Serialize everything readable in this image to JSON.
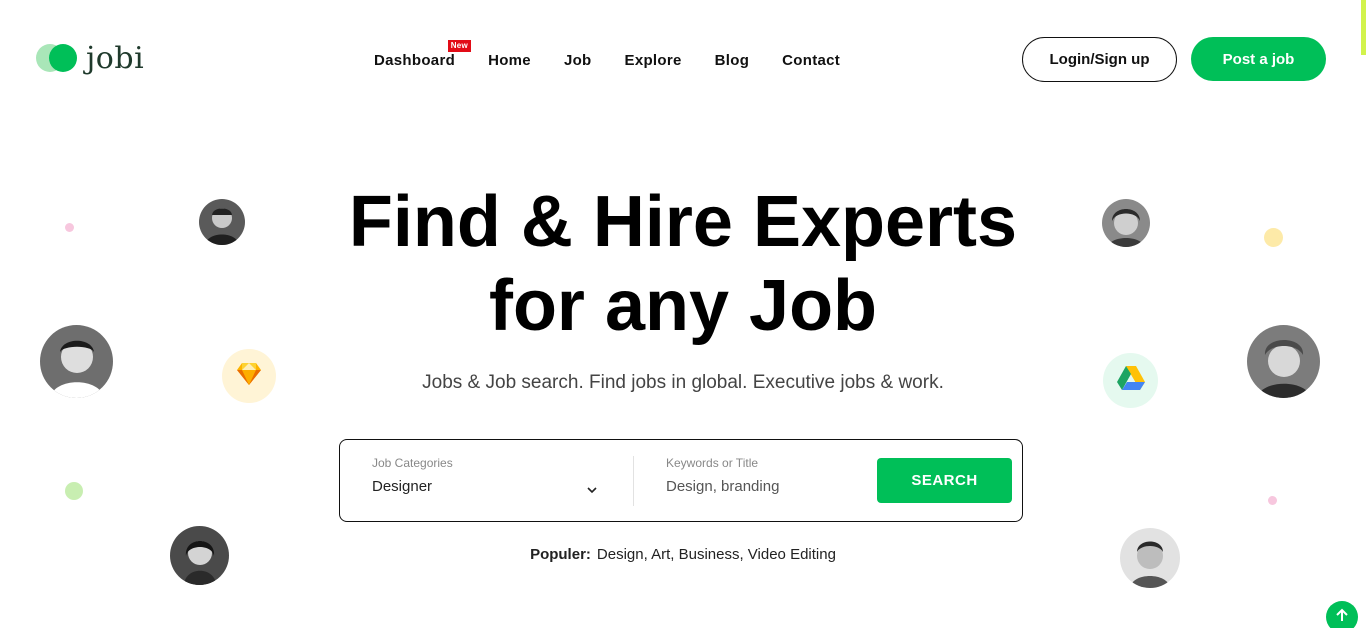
{
  "brand": {
    "name": "jobi"
  },
  "nav": {
    "items": [
      {
        "label": "Dashboard",
        "badge": "New"
      },
      {
        "label": "Home"
      },
      {
        "label": "Job"
      },
      {
        "label": "Explore"
      },
      {
        "label": "Blog"
      },
      {
        "label": "Contact"
      }
    ]
  },
  "header": {
    "login_label": "Login/Sign up",
    "post_label": "Post a job"
  },
  "hero": {
    "title_line1": "Find & Hire Experts",
    "title_line2": "for any Job",
    "subtitle": "Jobs & Job search. Find jobs in global. Executive jobs & work."
  },
  "search": {
    "category_label": "Job Categories",
    "category_value": "Designer",
    "keyword_label": "Keywords or Title",
    "keyword_placeholder": "Design, branding",
    "button_label": "SEARCH"
  },
  "popular": {
    "label": "Populer:",
    "tags": "Design, Art, Business, Video Editing"
  },
  "colors": {
    "accent": "#00bf58",
    "badge": "#e20c17",
    "edge_accent": "#d2f34c"
  },
  "icons": {
    "sketch": "sketch-diamond-icon",
    "drive": "google-drive-icon",
    "chevron": "chevron-down-icon",
    "scroll_top": "arrow-up-icon"
  }
}
